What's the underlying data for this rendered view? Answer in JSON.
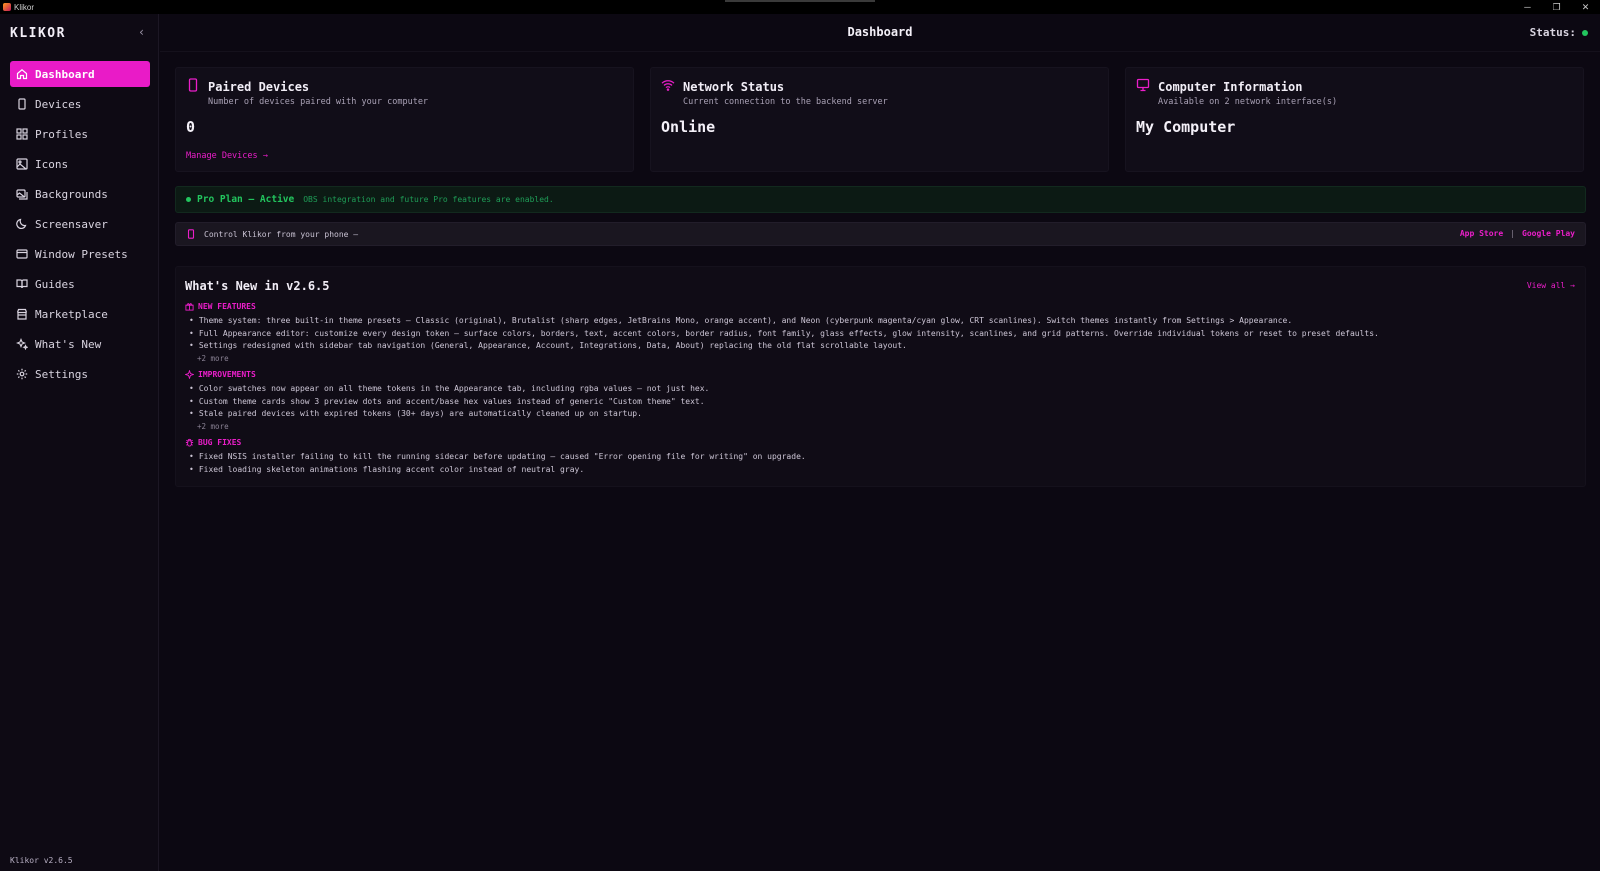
{
  "window": {
    "title": "Klikor",
    "controls": {
      "minimize": "─",
      "restore": "❐",
      "close": "✕"
    }
  },
  "sidebar": {
    "brand": "KLIKOR",
    "collapse_glyph": "‹",
    "items": [
      {
        "label": "Dashboard",
        "icon": "home-icon",
        "active": true
      },
      {
        "label": "Devices",
        "icon": "smartphone-icon"
      },
      {
        "label": "Profiles",
        "icon": "grid-icon"
      },
      {
        "label": "Icons",
        "icon": "image-icon"
      },
      {
        "label": "Backgrounds",
        "icon": "images-icon"
      },
      {
        "label": "Screensaver",
        "icon": "moon-icon"
      },
      {
        "label": "Window Presets",
        "icon": "window-icon"
      },
      {
        "label": "Guides",
        "icon": "book-icon"
      },
      {
        "label": "Marketplace",
        "icon": "store-icon"
      },
      {
        "label": "What's New",
        "icon": "sparkles-icon"
      },
      {
        "label": "Settings",
        "icon": "gear-icon"
      }
    ],
    "version": "Klikor v2.6.5"
  },
  "header": {
    "title": "Dashboard",
    "status_label": "Status:",
    "status_color": "#22c55e"
  },
  "cards": [
    {
      "title": "Paired Devices",
      "subtitle": "Number of devices paired with your computer",
      "value": "0",
      "link": "Manage Devices →",
      "icon": "smartphone-icon"
    },
    {
      "title": "Network Status",
      "subtitle": "Current connection to the backend server",
      "value": "Online",
      "icon": "wifi-icon"
    },
    {
      "title": "Computer Information",
      "subtitle": "Available on 2 network interface(s)",
      "value": "My Computer",
      "icon": "monitor-icon"
    }
  ],
  "pro_banner": {
    "label": "Pro Plan — Active",
    "text": "OBS integration and future Pro features are enabled."
  },
  "phone_banner": {
    "text": "Control Klikor from your phone —",
    "app_store": "App Store",
    "separator": "|",
    "google_play": "Google Play"
  },
  "whats_new": {
    "title": "What's New in v2.6.5",
    "view_all": "View all →",
    "sections": [
      {
        "heading": "NEW FEATURES",
        "icon": "gift-icon",
        "items": [
          "Theme system: three built-in theme presets — Classic (original), Brutalist (sharp edges, JetBrains Mono, orange accent), and Neon (cyberpunk magenta/cyan glow, CRT scanlines). Switch themes instantly from Settings > Appearance.",
          "Full Appearance editor: customize every design token — surface colors, borders, text, accent colors, border radius, font family, glass effects, glow intensity, scanlines, and grid patterns. Override individual tokens or reset to preset defaults.",
          "Settings redesigned with sidebar tab navigation (General, Appearance, Account, Integrations, Data, About) replacing the old flat scrollable layout."
        ],
        "more": "+2 more"
      },
      {
        "heading": "IMPROVEMENTS",
        "icon": "sparkle-icon",
        "items": [
          "Color swatches now appear on all theme tokens in the Appearance tab, including rgba values — not just hex.",
          "Custom theme cards show 3 preview dots and accent/base hex values instead of generic \"Custom theme\" text.",
          "Stale paired devices with expired tokens (30+ days) are automatically cleaned up on startup."
        ],
        "more": "+2 more"
      },
      {
        "heading": "BUG FIXES",
        "icon": "bug-icon",
        "items": [
          "Fixed NSIS installer failing to kill the running sidecar before updating — caused \"Error opening file for writing\" on upgrade.",
          "Fixed loading skeleton animations flashing accent color instead of neutral gray."
        ]
      }
    ]
  },
  "colors": {
    "accent": "#e91bc7",
    "success": "#22c55e",
    "background": "#0c0812"
  }
}
